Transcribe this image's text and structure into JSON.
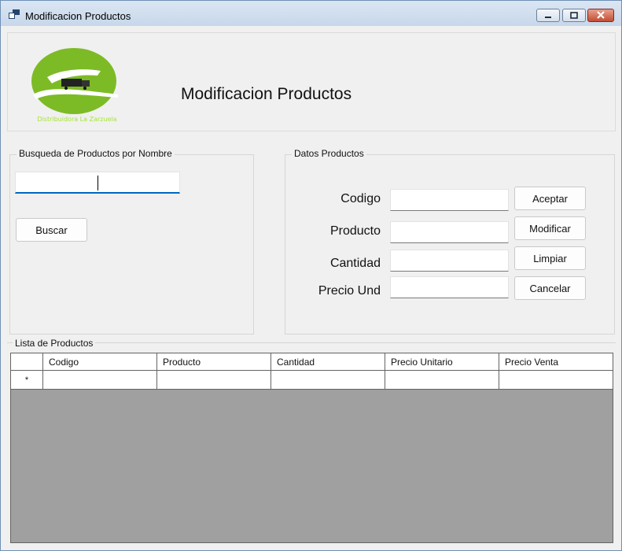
{
  "window": {
    "title": "Modificacion Productos"
  },
  "header": {
    "title": "Modificacion Productos",
    "logo_text": "Distribuidora La Zarzuela"
  },
  "search": {
    "group_label": "Busqueda de Productos por Nombre",
    "input_value": "",
    "button_label": "Buscar"
  },
  "product_data": {
    "group_label": "Datos Productos",
    "labels": {
      "codigo": "Codigo",
      "producto": "Producto",
      "cantidad": "Cantidad",
      "precio": "Precio Und"
    },
    "values": {
      "codigo": "",
      "producto": "",
      "cantidad": "",
      "precio": ""
    },
    "buttons": {
      "aceptar": "Aceptar",
      "modificar": "Modificar",
      "limpiar": "Limpiar",
      "cancelar": "Cancelar"
    }
  },
  "list": {
    "label": "Lista de Productos",
    "columns": [
      "Codigo",
      "Producto",
      "Cantidad",
      "Precio Unitario",
      "Precio Venta"
    ],
    "new_row_marker": "*"
  },
  "colors": {
    "logo_green": "#7dbb26",
    "logo_text": "#a6e23a",
    "grid_background": "#a0a0a0",
    "focus_blue": "#0067c0"
  }
}
